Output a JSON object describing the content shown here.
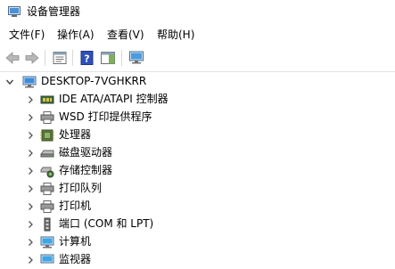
{
  "window": {
    "title": "设备管理器"
  },
  "menu": [
    "文件(F)",
    "操作(A)",
    "查看(V)",
    "帮助(H)"
  ],
  "toolbar": {
    "buttons": [
      "back-arrow-icon",
      "forward-arrow-icon",
      "properties-icon",
      "help-icon",
      "action-pane-icon",
      "monitor-scan-icon"
    ]
  },
  "tree": {
    "root": "DESKTOP-7VGHKRR",
    "items": [
      {
        "label": "IDE ATA/ATAPI 控制器",
        "icon": "ide-controller-icon"
      },
      {
        "label": "WSD 打印提供程序",
        "icon": "printer-icon"
      },
      {
        "label": "处理器",
        "icon": "processor-icon"
      },
      {
        "label": "磁盘驱动器",
        "icon": "disk-drive-icon"
      },
      {
        "label": "存储控制器",
        "icon": "storage-controller-icon"
      },
      {
        "label": "打印队列",
        "icon": "print-queue-icon"
      },
      {
        "label": "打印机",
        "icon": "printer-icon"
      },
      {
        "label": "端口 (COM 和 LPT)",
        "icon": "port-icon"
      },
      {
        "label": "计算机",
        "icon": "computer-icon"
      },
      {
        "label": "监视器",
        "icon": "monitor-icon"
      }
    ]
  }
}
